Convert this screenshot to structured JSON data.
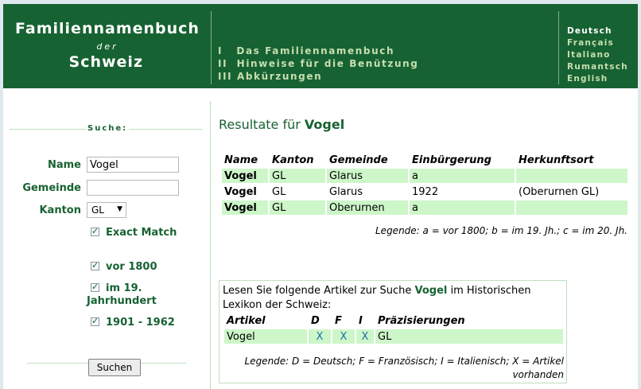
{
  "header": {
    "logo_line1": "Familiennamenbuch",
    "logo_line2": "der",
    "logo_line3": "Schweiz",
    "nav": [
      "I   Das Familiennamenbuch",
      "II  Hinweise für die Benützung",
      "III Abkürzungen"
    ],
    "languages": [
      "Deutsch",
      "Français",
      "Italiano",
      "Rumantsch",
      "English"
    ],
    "active_language": "Deutsch"
  },
  "search": {
    "title": "Suche:",
    "name_label": "Name",
    "name_value": "Vogel",
    "gemeinde_label": "Gemeinde",
    "gemeinde_value": "",
    "kanton_label": "Kanton",
    "kanton_value": "GL",
    "exact_match_label": "Exact Match",
    "exact_match_checked": true,
    "period_options": [
      {
        "label": "vor 1800",
        "checked": true
      },
      {
        "label": "im 19. Jahrhundert",
        "checked": true
      },
      {
        "label": "1901 - 1962",
        "checked": true
      }
    ],
    "button_label": "Suchen"
  },
  "results": {
    "title_prefix": "Resultate für",
    "query": "Vogel",
    "columns": [
      "Name",
      "Kanton",
      "Gemeinde",
      "Einbürgerung",
      "Herkunftsort"
    ],
    "rows": [
      [
        "Vogel",
        "GL",
        "Glarus",
        "a",
        ""
      ],
      [
        "Vogel",
        "GL",
        "Glarus",
        "1922",
        "(Oberurnen GL)"
      ],
      [
        "Vogel",
        "GL",
        "Oberurnen",
        "a",
        ""
      ]
    ],
    "legend": "Legende: a = vor 1800; b = im 19. Jh.; c = im 20. Jh."
  },
  "hls": {
    "intro_before": "Lesen Sie folgende Artikel zur Suche",
    "query": "Vogel",
    "intro_after": "im Historischen Lexikon der Schweiz:",
    "columns": [
      "Artikel",
      "D",
      "F",
      "I",
      "Präzisierungen"
    ],
    "rows": [
      [
        "Vogel",
        "X",
        "X",
        "X",
        "GL"
      ]
    ],
    "legend": "Legende: D = Deutsch; F = Französisch; I = Italienisch; X = Artikel vorhanden"
  },
  "colors": {
    "brand_green": "#176232",
    "row_highlight": "#cdf6c9",
    "nav_text": "#c7deb0"
  }
}
